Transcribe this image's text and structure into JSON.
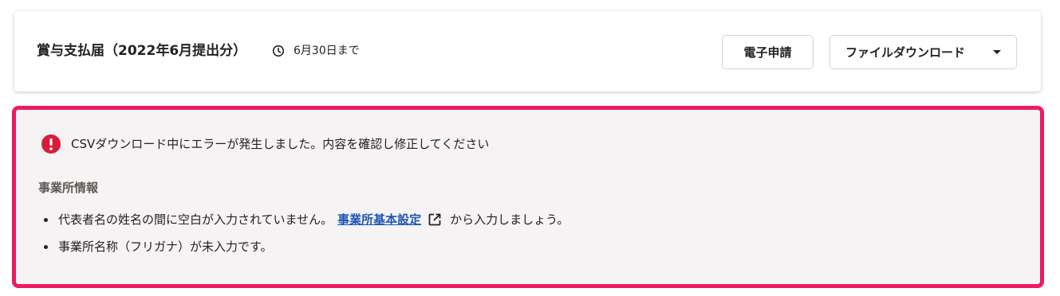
{
  "header": {
    "title": "賞与支払届（2022年6月提出分）",
    "deadline": "6月30日まで",
    "buttons": {
      "electronic_filing": "電子申請",
      "file_download": "ファイルダウンロード"
    }
  },
  "error": {
    "message": "CSVダウンロード中にエラーが発生しました。内容を確認し修正してください",
    "section_title": "事業所情報",
    "items": [
      {
        "text_before": "代表者名の姓名の間に空白が入力されていません。",
        "link": "事業所基本設定",
        "text_after": "から入力しましょう。"
      },
      {
        "text": "事業所名称（フリガナ）が未入力です。"
      }
    ]
  },
  "icons": {
    "deadline": "clock-icon",
    "dropdown": "caret-down-icon",
    "error": "error-alert-icon",
    "external_link": "external-link-icon"
  },
  "colors": {
    "error_border": "#ec1b5f",
    "error_icon": "#d91c3c",
    "link": "#1f55b5",
    "panel_background": "#f5f3f3"
  }
}
